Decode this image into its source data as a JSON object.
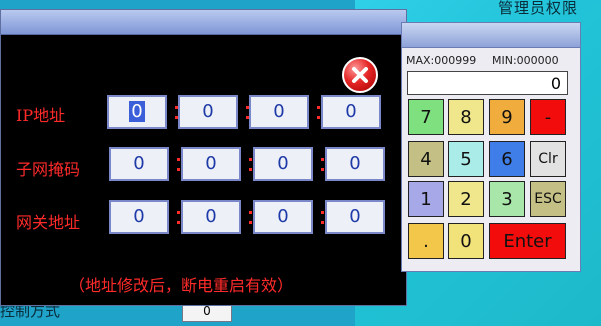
{
  "background": {
    "top_right_label": "管理员权限",
    "bottom_left_label": "控制方式",
    "bottom_field_value": "0"
  },
  "ip_dialog": {
    "rows": [
      {
        "label": "IP地址",
        "octets": [
          "0",
          "0",
          "0",
          "0"
        ]
      },
      {
        "label": "子网掩码",
        "octets": [
          "0",
          "0",
          "0",
          "0"
        ]
      },
      {
        "label": "网关地址",
        "octets": [
          "0",
          "0",
          "0",
          "0"
        ]
      }
    ],
    "note": "（地址修改后，断电重启有效）",
    "close_icon": "close-icon",
    "accent_color": "#ff2a2a"
  },
  "keypad": {
    "max_label": "MAX:000999",
    "min_label": "MIN:000000",
    "display_value": "0",
    "keys": {
      "k7": "7",
      "k8": "8",
      "k9": "9",
      "minus": "-",
      "k4": "4",
      "k5": "5",
      "k6": "6",
      "clr": "Clr",
      "k1": "1",
      "k2": "2",
      "k3": "3",
      "esc": "ESC",
      "dot": ".",
      "k0": "0",
      "enter": "Enter"
    }
  }
}
